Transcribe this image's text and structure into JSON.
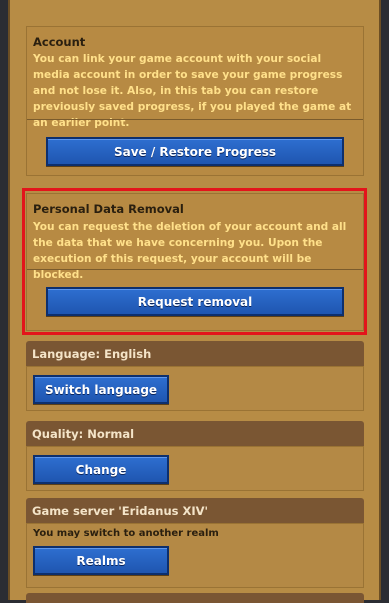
{
  "account": {
    "title": "Account",
    "text": "You can link your game account with your social media account in order to save your game progress and not lose it. Also, in this tab you can restore previously saved progress, if you played the game at an earlier point.",
    "button": "Save / Restore Progress"
  },
  "removal": {
    "title": "Personal Data Removal",
    "text": "You can request the deletion of your account and all the data that we have concerning you. Upon the execution of this request, your account will be blocked.",
    "button": "Request removal"
  },
  "language": {
    "header": "Language: English",
    "button": "Switch language"
  },
  "quality": {
    "header": "Quality: Normal",
    "button": "Change"
  },
  "server": {
    "header": "Game server 'Eridanus XIV'",
    "subtext": "You may switch to another realm",
    "button": "Realms"
  },
  "colors": {
    "panel": "#b78c45",
    "button_blue": "#2462c0",
    "card_header": "#7a5633",
    "text_yellow": "#ffe08a",
    "highlight": "#e3141b"
  }
}
